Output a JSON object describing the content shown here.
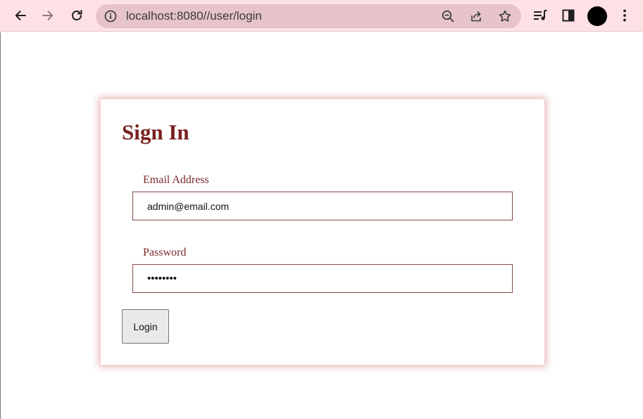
{
  "browser": {
    "url": "localhost:8080//user/login",
    "icons": {
      "back": "arrow-left-icon",
      "forward": "arrow-right-icon",
      "reload": "reload-icon",
      "site_info": "info-icon",
      "zoom": "zoom-out-icon",
      "share": "share-icon",
      "bookmark": "star-icon",
      "media": "media-queue-icon",
      "side_panel": "side-panel-icon",
      "profile": "avatar",
      "menu": "kebab-menu-icon"
    }
  },
  "login_form": {
    "title": "Sign In",
    "email_label": "Email Address",
    "email_value": "admin@email.com",
    "password_label": "Password",
    "password_value": "password",
    "submit_label": "Login"
  },
  "colors": {
    "toolbar_bg": "#fde1e5",
    "omnibox_bg": "#e6c4ca",
    "title": "#7a1f1f",
    "label": "#7a2a2a",
    "input_border": "#8a4a46",
    "card_shadow": "#c84646"
  }
}
